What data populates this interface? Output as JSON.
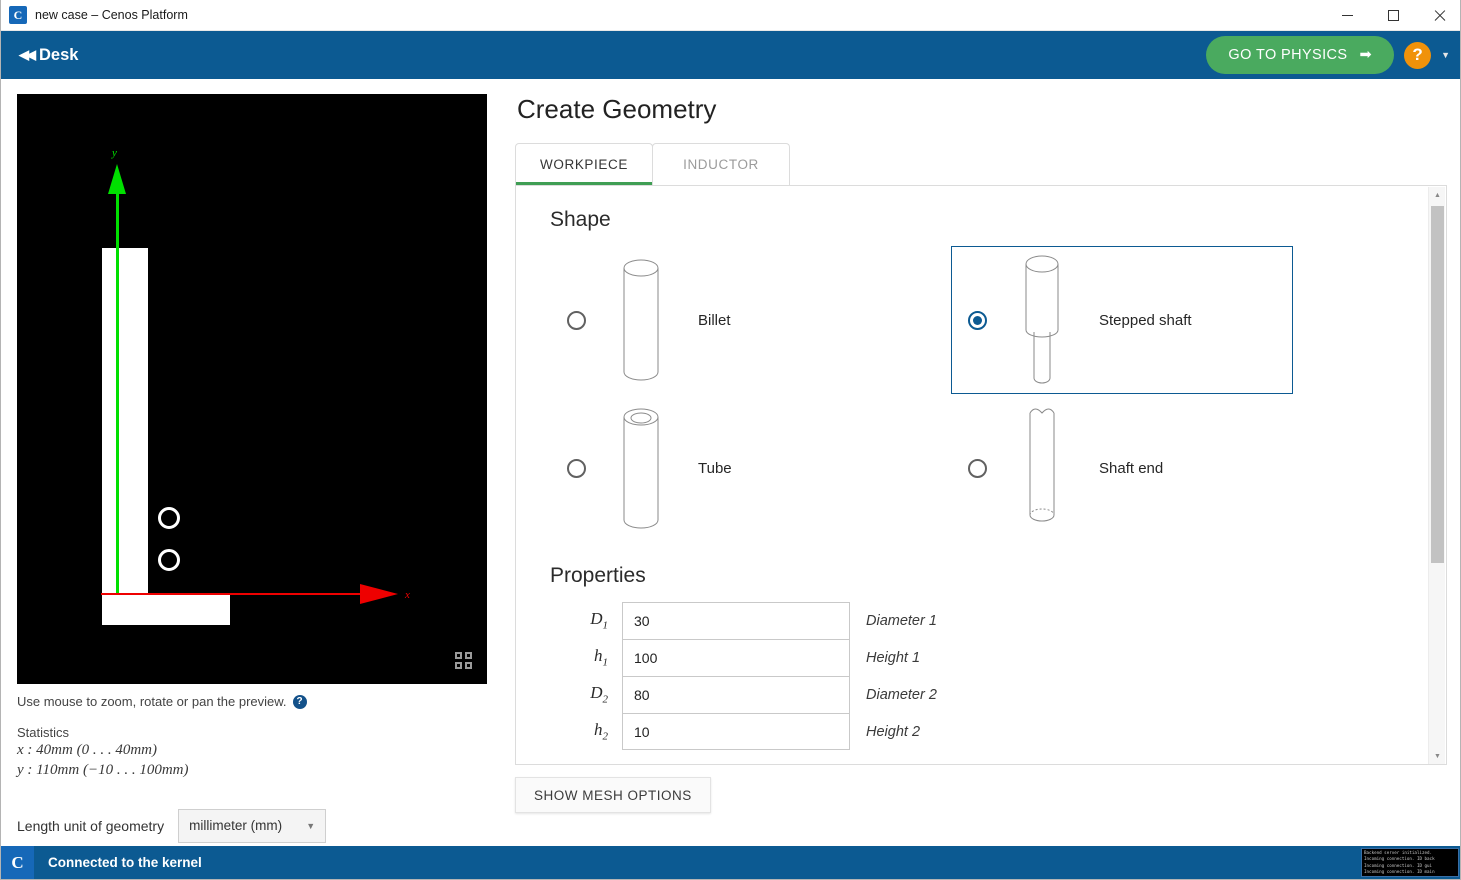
{
  "window": {
    "title": "new case – Cenos Platform",
    "app_icon": "app-logo-icon",
    "minimize": "–",
    "maximize": "□",
    "close": "✕"
  },
  "appbar": {
    "back_arrows": "◀◀",
    "desk_label": "Desk",
    "physics_button": "GO TO PHYSICS",
    "physics_arrow": "➡",
    "help_label": "?",
    "help_caret": "▼",
    "bg_color": "#0c5a92",
    "physics_color": "#4aaa5f",
    "help_color": "#f0920a"
  },
  "preview": {
    "y_axis_label": "y",
    "x_axis_label": "x",
    "y_axis_color": "#00e000",
    "x_axis_color": "#ee0000",
    "background": "#000000",
    "fullscreen_icon": "fullscreen-icon",
    "hint": "Use mouse to zoom, rotate or pan the preview.",
    "hint_help_icon": "?"
  },
  "statistics": {
    "heading": "Statistics",
    "lines": [
      "x : 40mm (0 . . . 40mm)",
      "y : 110mm (−10 . . . 100mm)"
    ]
  },
  "unit": {
    "label": "Length unit of geometry",
    "selected": "millimeter (mm)",
    "caret": "▼"
  },
  "main": {
    "title": "Create Geometry",
    "tabs": [
      {
        "label": "WORKPIECE",
        "active": true
      },
      {
        "label": "INDUCTOR",
        "active": false
      }
    ],
    "active_tab_underline": "#3f9e54",
    "shape_section": "Shape",
    "shapes": [
      {
        "label": "Billet",
        "icon": "cylinder-icon",
        "selected": false
      },
      {
        "label": "Stepped shaft",
        "icon": "stepped-shaft-icon",
        "selected": true
      },
      {
        "label": "Tube",
        "icon": "tube-icon",
        "selected": false
      },
      {
        "label": "Shaft end",
        "icon": "shaft-end-icon",
        "selected": false
      }
    ],
    "selected_border_color": "#0c5a92",
    "properties_section": "Properties",
    "properties": [
      {
        "symbol": "D",
        "sub": "1",
        "value": "30",
        "description": "Diameter 1"
      },
      {
        "symbol": "h",
        "sub": "1",
        "value": "100",
        "description": "Height 1"
      },
      {
        "symbol": "D",
        "sub": "2",
        "value": "80",
        "description": "Diameter 2"
      },
      {
        "symbol": "h",
        "sub": "2",
        "value": "10",
        "description": "Height 2"
      }
    ],
    "mesh_button": "SHOW MESH OPTIONS",
    "scroll_up": "▲",
    "scroll_down": "▼"
  },
  "statusbar": {
    "logo": "cenos-logo-icon",
    "text": "Connected to the kernel",
    "terminal_lines": [
      "Backend server initialized.",
      "Incoming connection. ID back",
      "Incoming connection. ID gui ",
      "Incoming connection. ID main"
    ]
  }
}
